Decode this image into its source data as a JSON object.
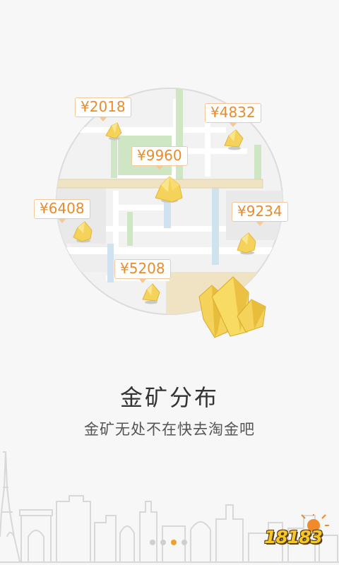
{
  "map": {
    "markers": [
      {
        "price": "¥2018"
      },
      {
        "price": "¥4832"
      },
      {
        "price": "¥9960"
      },
      {
        "price": "¥6408"
      },
      {
        "price": "¥9234"
      },
      {
        "price": "¥5208"
      }
    ]
  },
  "intro": {
    "title": "金矿分布",
    "subtitle": "金矿无处不在快去淘金吧"
  },
  "pager": {
    "total": 4,
    "current_index": 2
  },
  "watermark": {
    "text": "18183"
  },
  "colors": {
    "accent": "#f0a030",
    "price_text": "#e98c2b",
    "price_border": "#f3c99a",
    "gold": "#f5d35a",
    "map_green": "#cfe6c4",
    "map_blue": "#cfe2ee",
    "map_sand": "#efe3c4"
  },
  "icons": [
    "gold-ore-icon",
    "gold-crystal-icon",
    "map-pin-icon"
  ]
}
